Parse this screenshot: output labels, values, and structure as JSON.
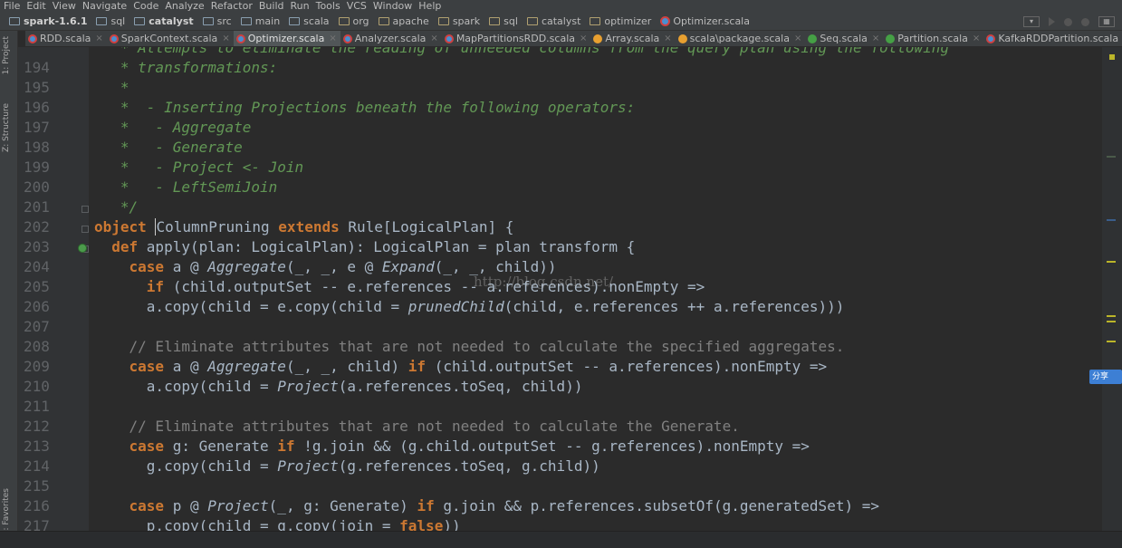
{
  "menu": [
    "File",
    "Edit",
    "View",
    "Navigate",
    "Code",
    "Analyze",
    "Refactor",
    "Build",
    "Run",
    "Tools",
    "VCS",
    "Window",
    "Help"
  ],
  "breadcrumbs": [
    {
      "label": "spark-1.6.1",
      "bold": true,
      "icon": "module"
    },
    {
      "label": "sql",
      "icon": "folder"
    },
    {
      "label": "catalyst",
      "bold": true,
      "icon": "folder"
    },
    {
      "label": "src",
      "icon": "folder"
    },
    {
      "label": "main",
      "icon": "folder"
    },
    {
      "label": "scala",
      "icon": "folder"
    },
    {
      "label": "org",
      "icon": "package"
    },
    {
      "label": "apache",
      "icon": "package"
    },
    {
      "label": "spark",
      "icon": "package"
    },
    {
      "label": "sql",
      "icon": "package"
    },
    {
      "label": "catalyst",
      "icon": "package"
    },
    {
      "label": "optimizer",
      "icon": "package"
    },
    {
      "label": "Optimizer.scala",
      "icon": "scala-file"
    }
  ],
  "tabs": [
    {
      "label": "RDD.scala",
      "icon": "scala"
    },
    {
      "label": "SparkContext.scala",
      "icon": "scala"
    },
    {
      "label": "Optimizer.scala",
      "icon": "scala",
      "active": true
    },
    {
      "label": "Analyzer.scala",
      "icon": "scala"
    },
    {
      "label": "MapPartitionsRDD.scala",
      "icon": "scala"
    },
    {
      "label": "Array.scala",
      "icon": "obj"
    },
    {
      "label": "scala\\package.scala",
      "icon": "obj"
    },
    {
      "label": "Seq.scala",
      "icon": "trait"
    },
    {
      "label": "Partition.scala",
      "icon": "trait"
    },
    {
      "label": "KafkaRDDPartition.scala",
      "icon": "scala"
    }
  ],
  "tool_windows": {
    "project": "1: Project",
    "structure": "Z: Structure",
    "favorites": "2: Favorites"
  },
  "share_badge": "分享",
  "watermark": "http://blog.csdn.net/",
  "line_numbers": [
    "194",
    "195",
    "196",
    "197",
    "198",
    "199",
    "200",
    "201",
    "202",
    "203",
    "204",
    "205",
    "206",
    "207",
    "208",
    "209",
    "210",
    "211",
    "212",
    "213",
    "214",
    "215",
    "216",
    "217"
  ],
  "code": {
    "top_partial": "   * Attempts to eliminate the reading of unneeded columns from the query plan using the following",
    "l194": "   * transformations:",
    "l195": "   *",
    "l196": "   *  - Inserting Projections beneath the following operators:",
    "l197": "   *   - Aggregate",
    "l198": "   *   - Generate",
    "l199": "   *   - Project <- Join",
    "l200": "   *   - LeftSemiJoin",
    "l201": "   */",
    "l202_kw1": "object ",
    "l202_name": "ColumnPruning ",
    "l202_kw2": "extends ",
    "l202_rest": "Rule[LogicalPlan] {",
    "l203_kw": "  def ",
    "l203_rest": "apply(plan: LogicalPlan): LogicalPlan = plan transform {",
    "l204_kw": "    case ",
    "l204_a": "a @ ",
    "l204_i1": "Aggregate",
    "l204_b": "(_, _, e @ ",
    "l204_i2": "Expand",
    "l204_c": "(_, _, child))",
    "l205_kw": "      if ",
    "l205_rest": "(child.outputSet -- e.references -- a.references).nonEmpty =>",
    "l206_a": "      a.copy(child = e.copy(child = ",
    "l206_i": "prunedChild",
    "l206_b": "(child, e.references ++ a.references)))",
    "l208": "    // Eliminate attributes that are not needed to calculate the specified aggregates.",
    "l209_kw": "    case ",
    "l209_a": "a @ ",
    "l209_i": "Aggregate",
    "l209_b": "(_, _, child) ",
    "l209_kw2": "if ",
    "l209_c": "(child.outputSet -- a.references).nonEmpty =>",
    "l210_a": "      a.copy(child = ",
    "l210_i": "Project",
    "l210_b": "(a.references.toSeq, child))",
    "l212": "    // Eliminate attributes that are not needed to calculate the Generate.",
    "l213_kw": "    case ",
    "l213_a": "g: Generate ",
    "l213_kw2": "if ",
    "l213_b": "!g.join && (g.child.outputSet -- g.references).nonEmpty =>",
    "l214_a": "      g.copy(child = ",
    "l214_i": "Project",
    "l214_b": "(g.references.toSeq, g.child))",
    "l216_kw": "    case ",
    "l216_a": "p @ ",
    "l216_i": "Project",
    "l216_b": "(_, g: Generate) ",
    "l216_kw2": "if ",
    "l216_c": "g.join && p.references.subsetOf(g.generatedSet) =>",
    "l217_a": "      p.copy(child = g.copy(join = ",
    "l217_kw": "false",
    "l217_b": "))"
  }
}
